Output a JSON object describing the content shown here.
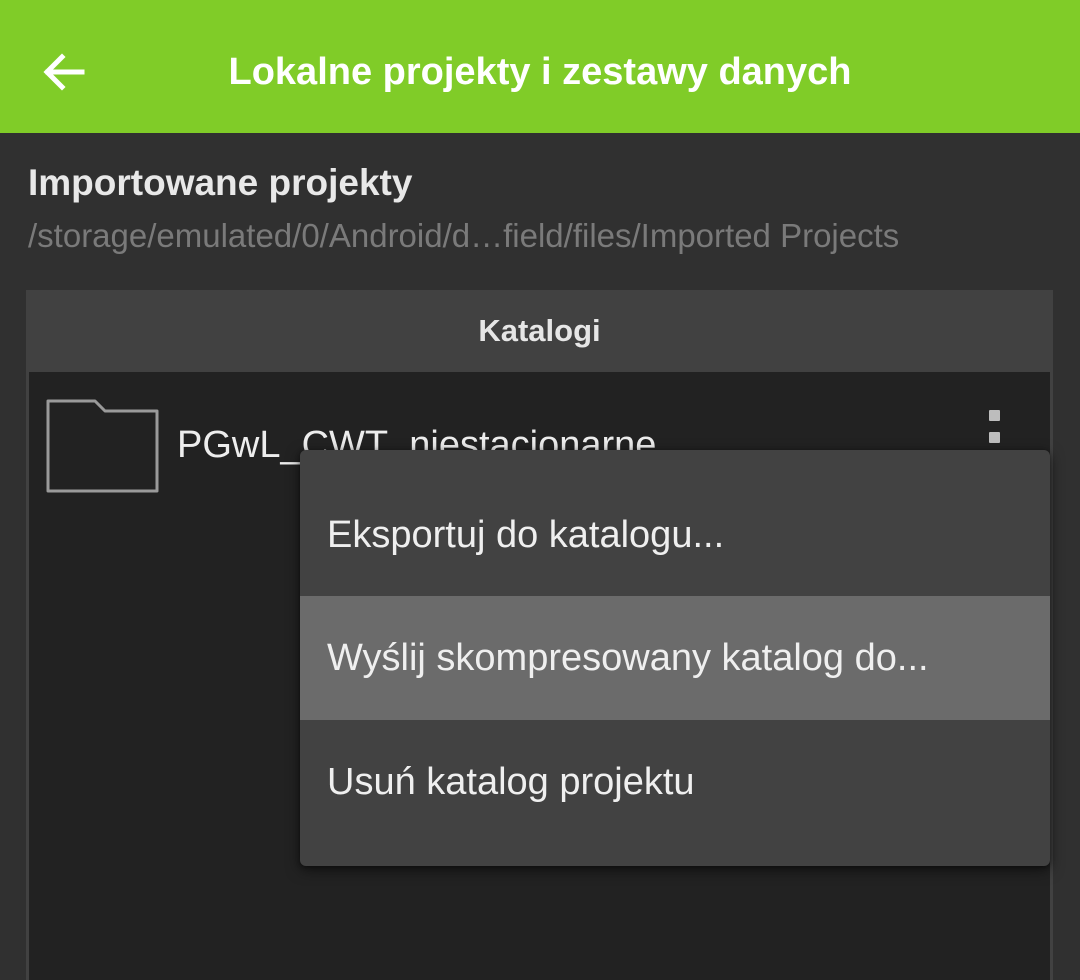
{
  "toolbar": {
    "title": "Lokalne projekty i zestawy danych",
    "back_icon": "arrow-left-icon",
    "background_color": "#80cc28"
  },
  "section": {
    "title": "Importowane projekty",
    "path": "/storage/emulated/0/Android/d…field/files/Imported Projects"
  },
  "panel": {
    "header": "Katalogi",
    "items": [
      {
        "icon": "folder-icon",
        "name": "PGwL_CWT_niestacjonarne",
        "menu_icon": "more-vertical-icon"
      }
    ]
  },
  "context_menu": {
    "items": [
      {
        "label": "Eksportuj do katalogu..."
      },
      {
        "label": "Wyślij skompresowany katalog do...",
        "highlighted": true
      },
      {
        "label": "Usuń katalog projektu"
      }
    ]
  }
}
